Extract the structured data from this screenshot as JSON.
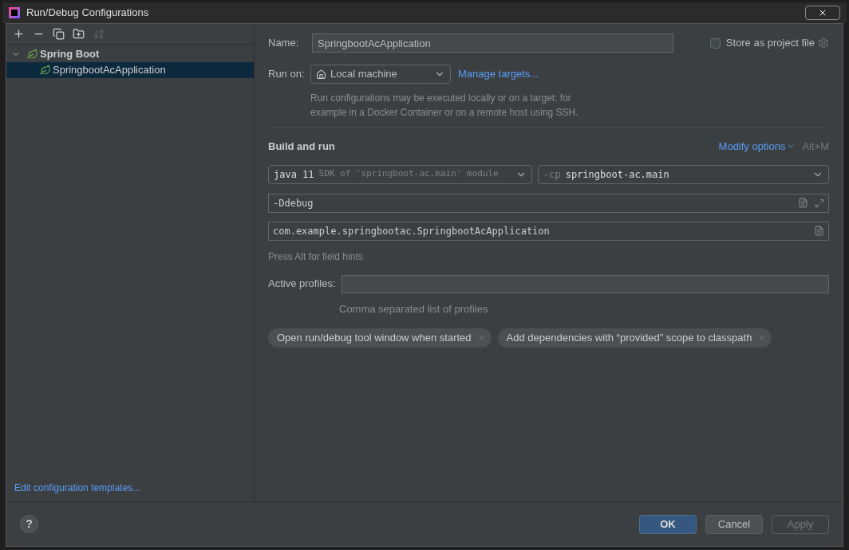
{
  "window": {
    "title": "Run/Debug Configurations"
  },
  "toolbar": [
    {
      "kind": "add",
      "disabled": false
    },
    {
      "kind": "remove",
      "disabled": false
    },
    {
      "kind": "copy",
      "disabled": false
    },
    {
      "kind": "folder",
      "disabled": false
    },
    {
      "kind": "sort",
      "disabled": true
    }
  ],
  "tree": [
    {
      "label": "Spring Boot",
      "expanded": true,
      "selected": false,
      "children": [
        {
          "label": "SpringbootAcApplication",
          "selected": true
        }
      ]
    }
  ],
  "edit_templates_link": "Edit configuration templates...",
  "name_field": {
    "label": "Name:",
    "value": "SpringbootAcApplication"
  },
  "store_as_project_file": {
    "label": "Store as project file",
    "checked": false
  },
  "run_on": {
    "label": "Run on:",
    "value": "Local machine",
    "link": "Manage targets...",
    "hint": "Run configurations may be executed locally or on a target: for example in a Docker Container or on a remote host using SSH."
  },
  "build_and_run": {
    "title": "Build and run",
    "modify_options": "Modify options",
    "shortcut": "Alt+M",
    "sdk": {
      "value": "java 11",
      "detail": "SDK of 'springboot-ac.main' module"
    },
    "classpath": {
      "prefix": "-cp",
      "value": "springboot-ac.main"
    },
    "vm_options": "-Ddebug",
    "main_class": "com.example.springbootac.SpringbootAcApplication",
    "field_hint": "Press Alt for field hints"
  },
  "active_profiles": {
    "label": "Active profiles:",
    "hint": "Comma separated list of profiles"
  },
  "option_chips": [
    "Open run/debug tool window when started",
    "Add dependencies with “provided” scope to classpath"
  ],
  "buttons": [
    {
      "label": "OK",
      "kind": "default",
      "disabled": false
    },
    {
      "label": "Cancel",
      "kind": "normal",
      "disabled": false
    },
    {
      "label": "Apply",
      "kind": "normal",
      "disabled": true
    }
  ],
  "help": "?"
}
